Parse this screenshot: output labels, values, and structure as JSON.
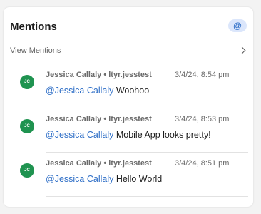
{
  "colors": {
    "avatar_bg": "#1f9350",
    "mention_link": "#2f6fc7",
    "badge_bg": "#dbe6fb",
    "badge_text": "#2f6fc7"
  },
  "header": {
    "title": "Mentions",
    "badge_icon": "at-sign-icon",
    "badge_symbol": "@"
  },
  "view_mentions": {
    "label": "View Mentions",
    "icon": "chevron-right-icon"
  },
  "mentions": [
    {
      "initials": "JC",
      "author_line": "Jessica Callaly • ltyr.jesstest",
      "timestamp": "3/4/24, 8:54 pm",
      "mention": "@Jessica Callaly",
      "text": " Woohoo"
    },
    {
      "initials": "JC",
      "author_line": "Jessica Callaly • ltyr.jesstest",
      "timestamp": "3/4/24, 8:53 pm",
      "mention": "@Jessica Callaly",
      "text": " Mobile App looks pretty!"
    },
    {
      "initials": "JC",
      "author_line": "Jessica Callaly • ltyr.jesstest",
      "timestamp": "3/4/24, 8:51 pm",
      "mention": "@Jessica Callaly",
      "text": " Hello World"
    }
  ]
}
